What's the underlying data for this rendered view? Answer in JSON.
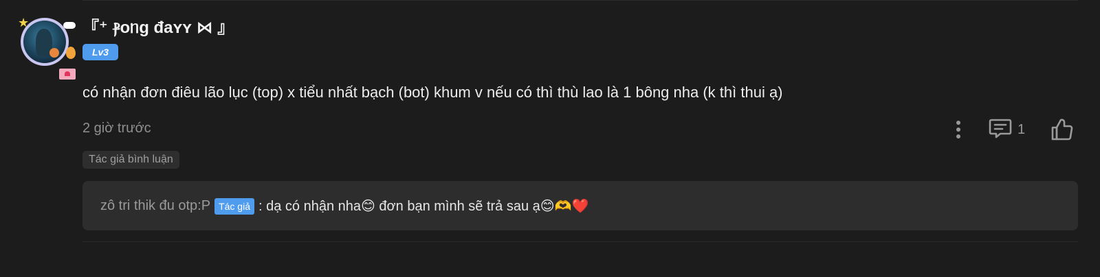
{
  "comment": {
    "username": "『⁺ ⳁoᥒg đaʏʏ ⋈ 』",
    "level": "Lv3",
    "text": "có nhận đơn điêu lão lục (top) x tiểu nhất bạch (bot) khum v nếu có thì thù lao là 1 bông nha (k thì thui ạ)",
    "timestamp": "2 giờ trước",
    "reply_count": "1",
    "author_tag": "Tác giả bình luận"
  },
  "reply": {
    "author": "zô tri thik đu otp:P",
    "author_badge": "Tác giả",
    "text": ": dạ có nhận nha😊 đơn bạn mình sẽ trả sau ạ😊🫶❤️"
  },
  "icons": {
    "more": "more-vertical-icon",
    "reply": "comment-icon",
    "like": "thumbs-up-icon"
  },
  "colors": {
    "background": "#1c1c1c",
    "accent": "#4f9cef",
    "reply_box": "#2d2d2d"
  }
}
